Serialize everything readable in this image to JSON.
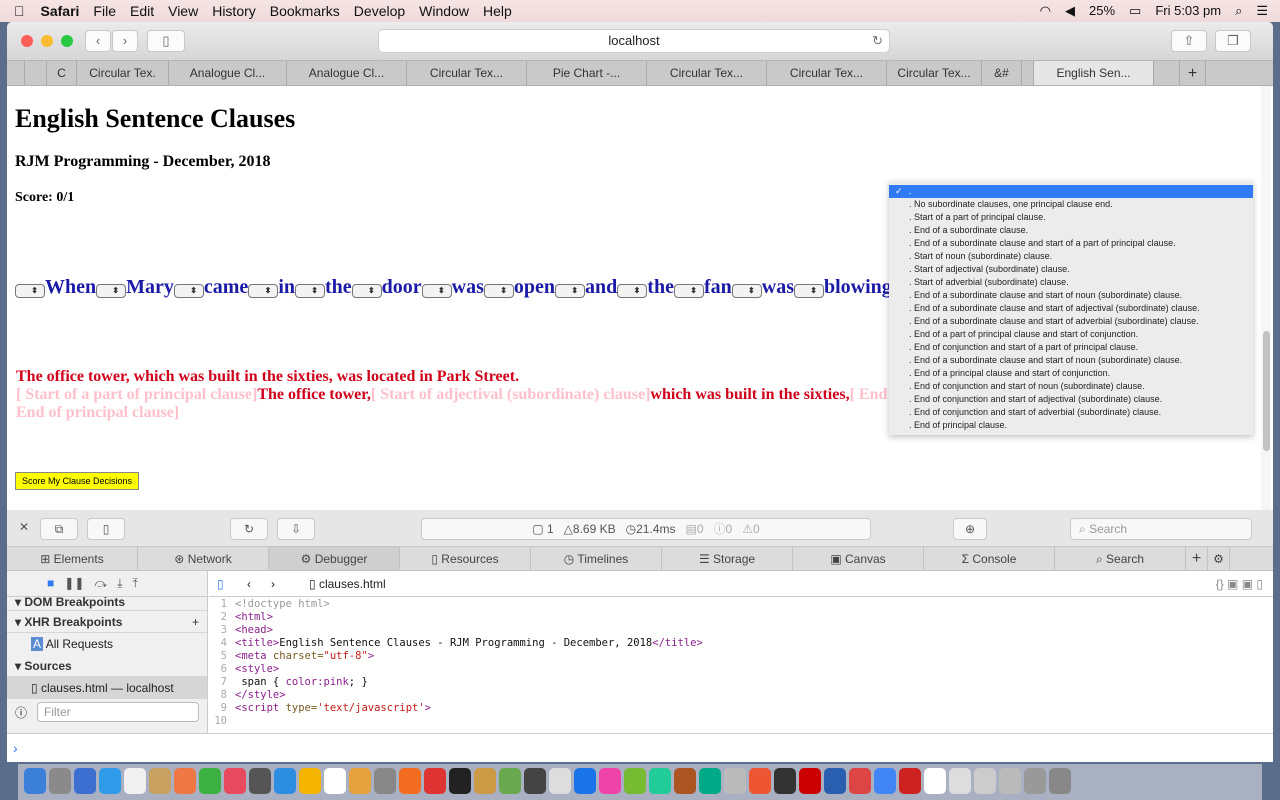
{
  "menubar": {
    "app": "Safari",
    "items": [
      "File",
      "Edit",
      "View",
      "History",
      "Bookmarks",
      "Develop",
      "Window",
      "Help"
    ],
    "battery": "25%",
    "clock": "Fri 5:03 pm"
  },
  "browser": {
    "url": "localhost",
    "tabs": [
      "C",
      "Circular Tex.",
      "Analogue Cl...",
      "Analogue Cl...",
      "Circular Tex...",
      "Pie Chart -...",
      "Circular Tex...",
      "Circular Tex...",
      "Circular Tex...",
      "&#",
      "English Sen..."
    ],
    "active_tab": 10
  },
  "page": {
    "title": "English Sentence Clauses",
    "subtitle": "RJM Programming - December, 2018",
    "score": "Score: 0/1",
    "words": [
      "When",
      "Mary",
      "came",
      "in",
      "the",
      "door",
      "was",
      "open",
      "and",
      "the",
      "fan",
      "was",
      "blowing"
    ],
    "sentence_plain": "The office tower, which was built in the sixties, was located in Park Street.",
    "annotated": [
      {
        "t": "[   Start of a part of principal clause]",
        "pink": true
      },
      {
        "t": "The office tower,",
        "pink": false
      },
      {
        "t": "[ Start of adjectival (subordinate) clause]",
        "pink": true
      },
      {
        "t": "which was built in the sixties,",
        "pink": false
      },
      {
        "t": "[ End of a subordinate clause]",
        "pink": true
      },
      {
        "t": "was located in Park Street.",
        "pink": false
      },
      {
        "t": "[ End of principal clause]",
        "pink": true
      }
    ],
    "score_button": "Score My Clause Decisions",
    "dropdown_options": [
      ".",
      ". No subordinate clauses, one principal clause end.",
      ". Start of a part of principal clause.",
      ". End of a subordinate clause.",
      ". End of a subordinate clause and start of a part of principal clause.",
      ". Start of noun (subordinate) clause.",
      ". Start of adjectival (subordinate) clause.",
      ". Start of adverbial (subordinate) clause.",
      ". End of a subordinate clause and start of noun (subordinate) clause.",
      ". End of a subordinate clause and start of adjectival (subordinate) clause.",
      ". End of a subordinate clause and start of adverbial (subordinate) clause.",
      ". End of a part of principal clause and start of conjunction.",
      ". End of conjunction and start of a part of principal clause.",
      ". End of a subordinate clause and start of noun (subordinate) clause.",
      ". End of a principal clause and start of conjunction.",
      ". End of conjunction and start of noun (subordinate) clause.",
      ". End of conjunction and start of adjectival (subordinate) clause.",
      ". End of conjunction and start of adverbial (subordinate) clause.",
      ". End of principal clause."
    ],
    "dropdown_selected": 0
  },
  "devtools": {
    "stats": {
      "resources": "1",
      "size": "8.69 KB",
      "time": "21.4ms",
      "logs": "0",
      "errors": "0",
      "warnings": "0"
    },
    "search_placeholder": "Search",
    "tabs": [
      "Elements",
      "Network",
      "Debugger",
      "Resources",
      "Timelines",
      "Storage",
      "Canvas",
      "Console",
      "Search"
    ],
    "active_tab": 2,
    "sidebar": {
      "dom_breakpoints": "DOM Breakpoints",
      "xhr_breakpoints": "XHR Breakpoints",
      "all_requests": "All Requests",
      "sources": "Sources",
      "source_file": "clauses.html — localhost",
      "filter_placeholder": "Filter"
    },
    "file": "clauses.html",
    "code": [
      [
        {
          "k": "comment",
          "t": "<!doctype html>"
        }
      ],
      [
        {
          "k": "tag",
          "t": "<html>"
        }
      ],
      [
        {
          "k": "tag",
          "t": "<head>"
        }
      ],
      [
        {
          "k": "tag",
          "t": "<title>"
        },
        {
          "k": "text",
          "t": "English Sentence Clauses - RJM Programming - December, 2018"
        },
        {
          "k": "tag",
          "t": "</title>"
        }
      ],
      [
        {
          "k": "tag",
          "t": "<meta "
        },
        {
          "k": "attr",
          "t": "charset="
        },
        {
          "k": "str",
          "t": "\"utf-8\""
        },
        {
          "k": "tag",
          "t": ">"
        }
      ],
      [
        {
          "k": "tag",
          "t": "<style>"
        }
      ],
      [
        {
          "k": "text",
          "t": " span { "
        },
        {
          "k": "tag",
          "t": "color:pink"
        },
        {
          "k": "text",
          "t": "; }"
        }
      ],
      [
        {
          "k": "tag",
          "t": "</style>"
        }
      ],
      [
        {
          "k": "tag",
          "t": "<script "
        },
        {
          "k": "attr",
          "t": "type="
        },
        {
          "k": "str",
          "t": "'text/javascript'"
        },
        {
          "k": "tag",
          "t": ">"
        }
      ],
      []
    ]
  },
  "colors": {
    "sentence": "#1a1aa6",
    "red": "#d0021b",
    "annotation": "pink",
    "score_button": "#ffff00",
    "selection": "#2f7bf5"
  }
}
